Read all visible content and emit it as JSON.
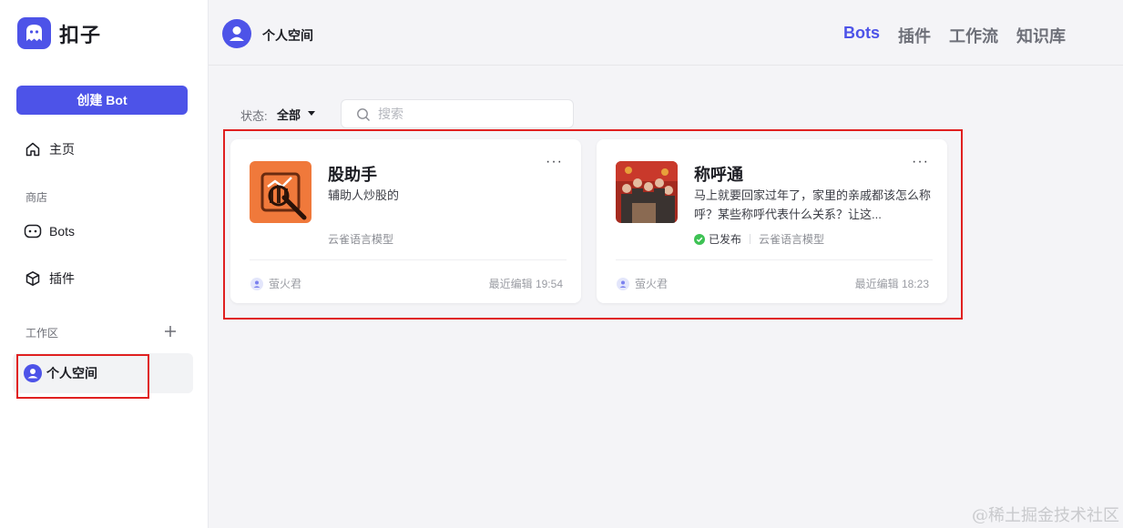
{
  "app": {
    "name": "扣子"
  },
  "sidebar": {
    "create_label": "创建 Bot",
    "home_label": "主页",
    "store_section": "商店",
    "store_items": [
      {
        "label": "Bots"
      },
      {
        "label": "插件"
      }
    ],
    "workspace_section": "工作区",
    "workspace_item": "个人空间"
  },
  "header": {
    "space_name": "个人空间",
    "tabs": [
      {
        "label": "Bots",
        "active": true
      },
      {
        "label": "插件"
      },
      {
        "label": "工作流"
      },
      {
        "label": "知识库"
      }
    ]
  },
  "filters": {
    "status_label": "状态:",
    "status_value": "全部",
    "search_placeholder": "搜索"
  },
  "bots": [
    {
      "name": "股助手",
      "description": "辅助人炒股的",
      "published": false,
      "model": "云雀语言模型",
      "author": "萤火君",
      "edited": "最近编辑 19:54"
    },
    {
      "name": "称呼通",
      "description": "马上就要回家过年了，家里的亲戚都该怎么称呼？某些称呼代表什么关系？让这...",
      "published": true,
      "published_label": "已发布",
      "model": "云雀语言模型",
      "author": "萤火君",
      "edited": "最近编辑 18:23"
    }
  ],
  "watermark": "@稀土掘金技术社区",
  "colors": {
    "accent": "#4d53e8",
    "highlight": "#e02020",
    "published": "#3ec254"
  }
}
